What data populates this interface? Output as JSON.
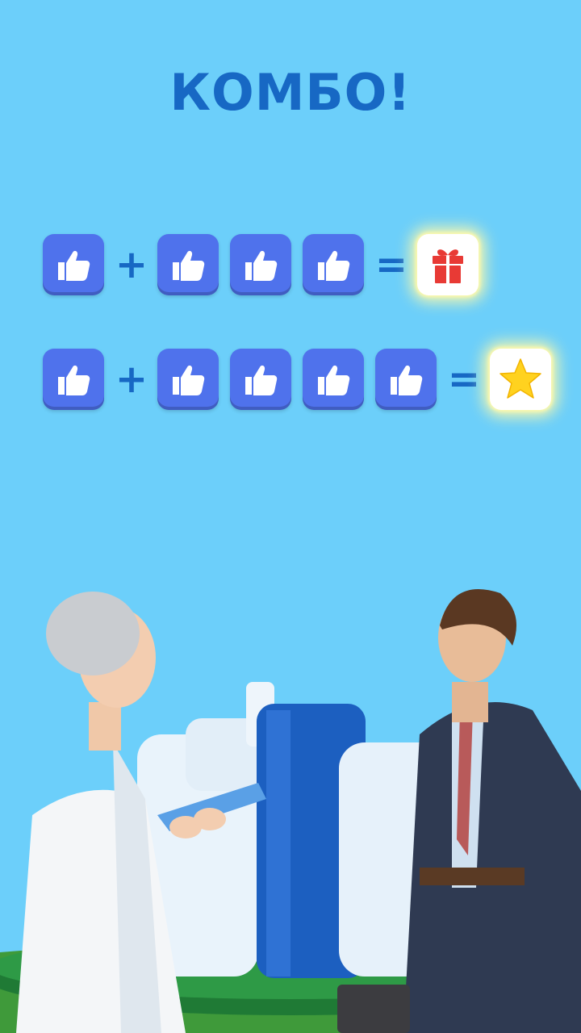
{
  "title": "КОМБО!",
  "combos": [
    {
      "start_icon": "thumbs-up-icon",
      "count_after_plus": 3,
      "plus": "+",
      "equals": "=",
      "reward_icon": "gift-icon"
    },
    {
      "start_icon": "thumbs-up-icon",
      "count_after_plus": 4,
      "plus": "+",
      "equals": "=",
      "reward_icon": "star-icon"
    }
  ],
  "colors": {
    "background": "#6ccffa",
    "accent": "#1768c4",
    "tile": "#4f72ec",
    "gift": "#e83a35",
    "star": "#ffd21f"
  }
}
